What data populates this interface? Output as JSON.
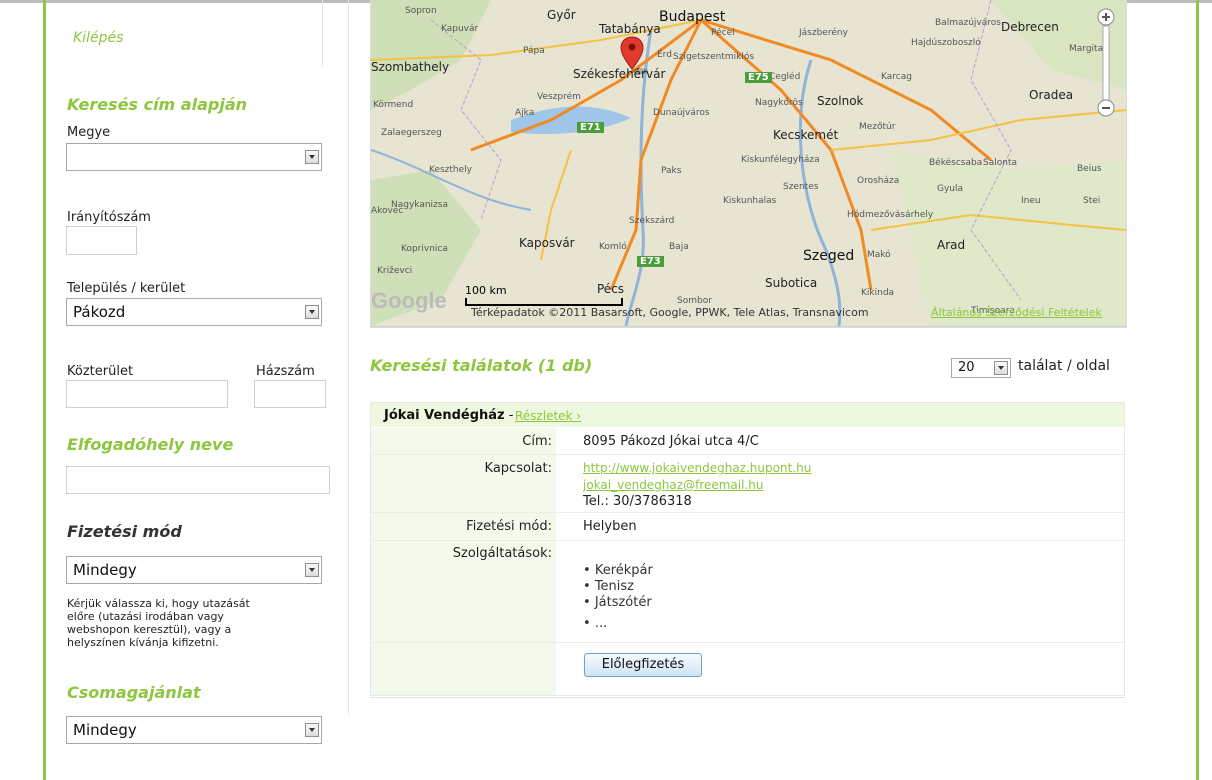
{
  "sidebar": {
    "logout": "Kilépés",
    "search_by_address": "Keresés cím alapján",
    "county_label": "Megye",
    "county_value": "",
    "zip_label": "Irányítószám",
    "zip_value": "",
    "city_label": "Település / kerület",
    "city_value": "Pákozd",
    "street_label": "Közterület",
    "house_label": "Házszám",
    "place_name_title": "Elfogadóhely neve",
    "payment_title": "Fizetési mód",
    "payment_value": "Mindegy",
    "payment_note": [
      "Kérjük válassza ki, hogy utazását",
      "előre (utazási irodában vagy",
      "webshopon keresztül), vagy a",
      "helyszínen kívánja kifizetni."
    ],
    "package_title": "Csomagajánlat",
    "package_value": "Mindegy"
  },
  "map": {
    "cities": [
      "Budapest",
      "Győr",
      "Tatabánya",
      "Pápa",
      "Szombathely",
      "Székesfehérvár",
      "Veszprém",
      "Ajka",
      "Körmend",
      "Zalaegerszeg",
      "Keszthely",
      "Nagykanizsa",
      "Kaposvár",
      "Pécs",
      "Szekszárd",
      "Baja",
      "Komló",
      "Dunaújváros",
      "Kecskemét",
      "Szolnok",
      "Cegléd",
      "Nagykőrös",
      "Kiskunfélegyháza",
      "Kiskunhalas",
      "Szentes",
      "Orosháza",
      "Békéscsaba",
      "Gyula",
      "Hódmezővásárhely",
      "Szeged",
      "Makó",
      "Arad",
      "Subotica",
      "Debrecen",
      "Hajdúszoboszló",
      "Oradea",
      "Salonta",
      "Jászberény",
      "Karcag",
      "Érd",
      "Pécel",
      "Szigetszentmiklós",
      "Balmazújváros",
      "Margita",
      "Mezőtúr",
      "Koprivnica",
      "Križevci",
      "Kapuvár",
      "Sopron",
      "Sombor",
      "Timișoara",
      "Beius",
      "Ineu",
      "Stei",
      "Kikinda",
      "Paks",
      "Akovec"
    ],
    "highways": [
      "E75",
      "E71",
      "E73"
    ],
    "scale": "100 km",
    "copyright": "Térképadatok ©2011 Basarsoft, Google, PPWK, Tele Atlas, Transnavicom",
    "terms_link": "Általános Szerződési Feltételek"
  },
  "results": {
    "title": "Keresési találatok (1 db)",
    "per_page_value": "20",
    "per_page_label": "találat / oldal",
    "item": {
      "name": "Jókai Vendégház",
      "separator": " - ",
      "details_link": "Részletek ›",
      "address_label": "Cím:",
      "address": "8095 Pákozd Jókai utca 4/C",
      "contact_label": "Kapcsolat:",
      "website": "http://www.jokaivendeghaz.hupont.hu",
      "email": "jokai_vendeghaz@freemail.hu",
      "phone": "Tel.: 30/3786318",
      "payment_label": "Fizetési mód:",
      "payment": "Helyben",
      "services_label": "Szolgáltatások:",
      "services": [
        "Kerékpár",
        "Tenisz",
        "Játszótér",
        "..."
      ],
      "prepay_button": "Előlegfizetés"
    }
  },
  "colors": {
    "accent": "#8dc63f",
    "header_bg": "#eef8df",
    "label_bg": "#f3faeb"
  }
}
